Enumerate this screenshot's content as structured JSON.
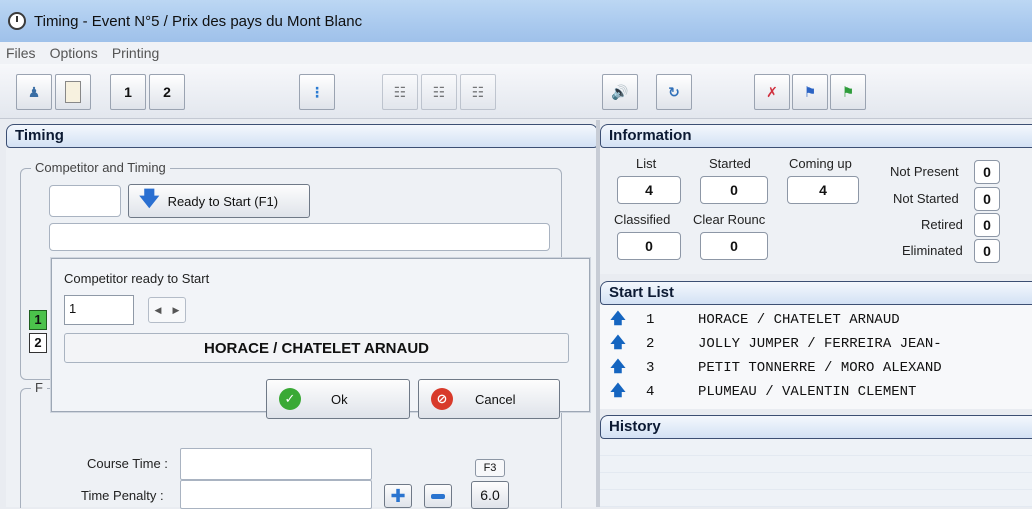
{
  "window": {
    "title": "Timing - Event N°5 / Prix des pays du Mont Blanc"
  },
  "menu": [
    "Files",
    "Options",
    "Printing"
  ],
  "toolbar": {
    "start1": "1",
    "start2": "2"
  },
  "timing": {
    "header": "Timing",
    "group_label": "Competitor and Timing",
    "ready_button": "Ready to Start (F1)",
    "badge1": "1",
    "badge2": "2",
    "group2_label": "F",
    "course_time_label": "Course Time :",
    "time_penalty_label": "Time Penalty :",
    "f3_label": "F3",
    "penalty_value": "6.0"
  },
  "dialog": {
    "title": "Competitor ready to Start",
    "number_value": "1",
    "competitor_name": "HORACE / CHATELET ARNAUD",
    "ok": "Ok",
    "cancel": "Cancel"
  },
  "information": {
    "header": "Information",
    "list_label": "List",
    "list_value": "4",
    "started_label": "Started",
    "started_value": "0",
    "coming_label": "Coming up",
    "coming_value": "4",
    "classified_label": "Classified",
    "classified_value": "0",
    "clear_label": "Clear Rounc",
    "clear_value": "0",
    "not_present_label": "Not Present",
    "not_present_value": "0",
    "not_started_label": "Not Started",
    "not_started_value": "0",
    "retired_label": "Retired",
    "retired_value": "0",
    "eliminated_label": "Eliminated",
    "eliminated_value": "0"
  },
  "start_list": {
    "header": "Start List",
    "rows": [
      {
        "num": "1",
        "name": "HORACE / CHATELET ARNAUD"
      },
      {
        "num": "2",
        "name": "JOLLY JUMPER / FERREIRA JEAN-"
      },
      {
        "num": "3",
        "name": "PETIT TONNERRE / MORO ALEXAND"
      },
      {
        "num": "4",
        "name": "PLUMEAU / VALENTIN CLEMENT"
      }
    ]
  },
  "history": {
    "header": "History"
  },
  "colors": {
    "header_border": "#3c4f73",
    "arrow": "#1565c0",
    "ok_green": "#3aa935",
    "cancel_red": "#d83a2a"
  }
}
